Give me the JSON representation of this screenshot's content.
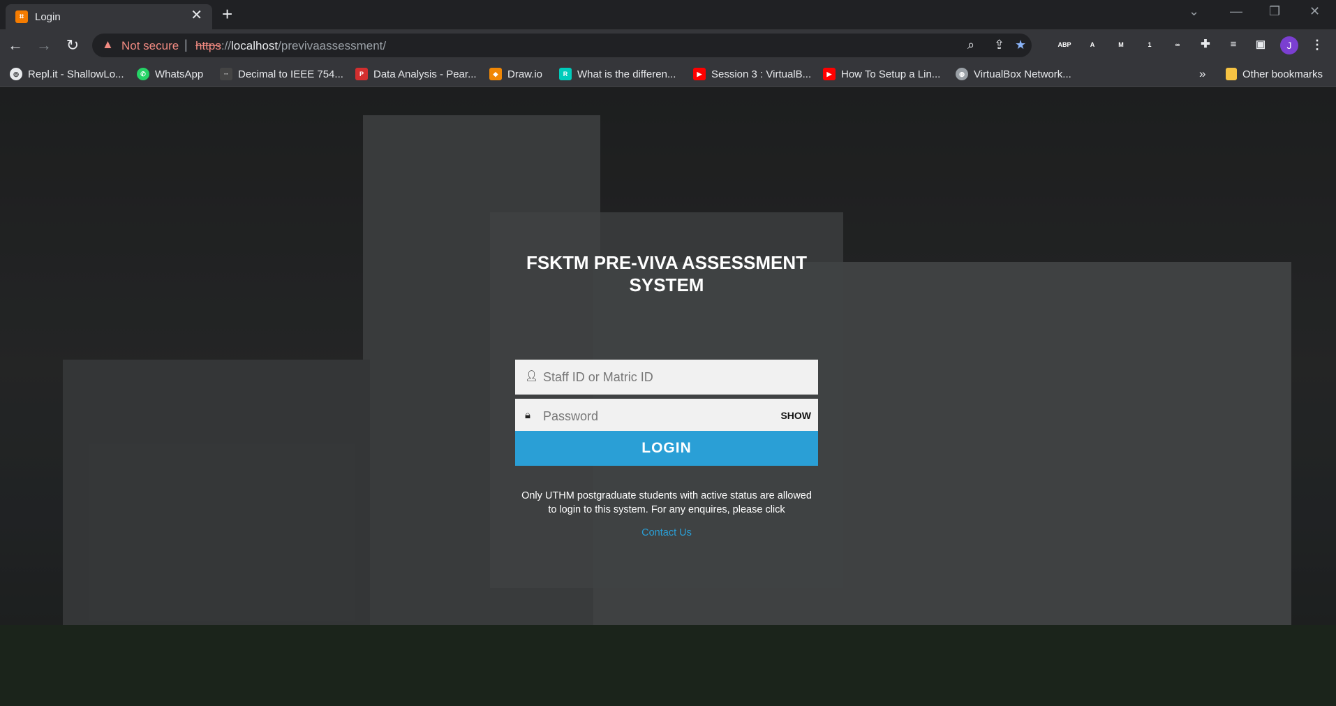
{
  "browser": {
    "tab": {
      "title": "Login",
      "close": "✕"
    },
    "new_tab": "+",
    "window_controls": {
      "tabs_menu": "⌄",
      "minimize": "—",
      "restore": "❐",
      "close": "✕"
    },
    "nav": {
      "back": "←",
      "forward": "→",
      "reload": "↻"
    },
    "omnibox": {
      "security_label": "Not secure",
      "url_scheme": "https",
      "url_host": "localhost",
      "url_path": "/previvaassessment/"
    },
    "extensions": [
      {
        "name": "abp-icon",
        "label": "ABP",
        "color": "#e53935"
      },
      {
        "name": "acrobat-icon",
        "label": "A",
        "color": "#c62828"
      },
      {
        "name": "mendeley-icon",
        "label": "M",
        "color": "#d32f2f"
      },
      {
        "name": "screen-recorder-icon",
        "label": "1",
        "color": "#555555"
      },
      {
        "name": "vr-icon",
        "label": "∞",
        "color": "#777777"
      }
    ],
    "avatar_initial": "J",
    "bookmarks": [
      {
        "label": "Repl.it - ShallowLo...",
        "icon": "replit-icon",
        "color": "#e8eaed"
      },
      {
        "label": "WhatsApp",
        "icon": "whatsapp-icon",
        "color": "#25d366"
      },
      {
        "label": "Decimal to IEEE 754...",
        "icon": "h-schmidt-icon",
        "color": "#444444"
      },
      {
        "label": "Data Analysis - Pear...",
        "icon": "pearson-icon",
        "color": "#d32f2f"
      },
      {
        "label": "Draw.io",
        "icon": "drawio-icon",
        "color": "#f08705"
      },
      {
        "label": "What is the differen...",
        "icon": "researchgate-icon",
        "color": "#00ccbb"
      },
      {
        "label": "Session 3 : VirtualB...",
        "icon": "youtube-icon",
        "color": "#ff0000"
      },
      {
        "label": "How To Setup a Lin...",
        "icon": "youtube-icon",
        "color": "#ff0000"
      },
      {
        "label": "VirtualBox Network...",
        "icon": "globe-icon",
        "color": "#9aa0a6"
      }
    ],
    "bookmarks_overflow": "»",
    "other_bookmarks": "Other bookmarks"
  },
  "login": {
    "title": "FSKTM PRE-VIVA ASSESSMENT SYSTEM",
    "username_placeholder": "Staff ID or Matric ID",
    "password_placeholder": "Password",
    "show_label": "SHOW",
    "submit_label": "LOGIN",
    "notice": "Only UTHM postgraduate students with active status are allowed to login to this system. For any enquires, please click",
    "contact_label": "Contact Us"
  },
  "colors": {
    "accent": "#2a9fd6",
    "warning": "#f28b82"
  }
}
